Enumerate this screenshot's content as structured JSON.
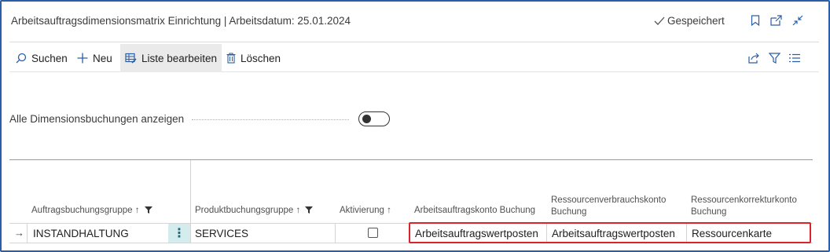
{
  "header": {
    "title": "Arbeitsauftragsdimensionsmatrix Einrichtung | Arbeitsdatum: 25.01.2024",
    "saved_status": "Gespeichert",
    "icons": [
      "bookmark-icon",
      "open-new-window-icon",
      "collapse-icon"
    ]
  },
  "toolbar": {
    "search_label": "Suchen",
    "new_label": "Neu",
    "edit_list_label": "Liste bearbeiten",
    "delete_label": "Löschen",
    "right_icons": [
      "share-icon",
      "filter-icon",
      "list-view-icon"
    ]
  },
  "filter_field": {
    "label": "Alle Dimensionsbuchungen anzeigen",
    "toggle_on": false
  },
  "table": {
    "columns": [
      {
        "line1": "Auftragsbuchungsgruppe ↑",
        "line2": ""
      },
      {
        "line1": "Produktbuchungsgruppe ↑",
        "line2": ""
      },
      {
        "line1": "Aktivierung ↑",
        "line2": ""
      },
      {
        "line1": "Arbeitsauftragskonto Buchung",
        "line2": ""
      },
      {
        "line1": "Ressourcenverbrauchskonto",
        "line2": "Buchung"
      },
      {
        "line1": "Ressourcenkorrekturkonto",
        "line2": "Buchung"
      }
    ],
    "rows": [
      {
        "order_group": "INSTANDHALTUNG",
        "product_group": "SERVICES",
        "activation": false,
        "work_order_posting": "Arbeitsauftragswertposten",
        "resource_usage_posting": "Arbeitsauftragswertposten",
        "resource_correction_posting": "Ressourcenkarte"
      }
    ]
  },
  "colors": {
    "frame_border": "#2a5ea8",
    "highlight_border": "#d9252a",
    "menu_cell_bg": "#d5ecef",
    "accent": "#1d6b77"
  }
}
